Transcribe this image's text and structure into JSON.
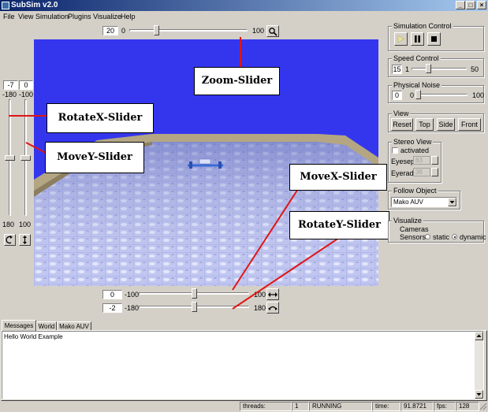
{
  "window": {
    "title": "SubSim v2.0",
    "min": "_",
    "max": "□",
    "close": "×"
  },
  "menu": [
    "File",
    "View",
    "Simulation",
    "Plugins",
    "Visualize",
    "Help"
  ],
  "zoom": {
    "value": "20",
    "min": "0",
    "max": "100",
    "fraction": 0.22
  },
  "rotate_x": {
    "value": "-7",
    "min": "-180",
    "max": "180",
    "fraction": 0.5
  },
  "move_y": {
    "value": "0",
    "min": "-100",
    "max": "100",
    "fraction": 0.5
  },
  "move_x": {
    "value": "0",
    "min": "-100",
    "max": "100",
    "fraction": 0.5
  },
  "rotate_y": {
    "value": "-2",
    "min": "-180",
    "max": "180",
    "fraction": 0.5
  },
  "annotations": {
    "zoom": "Zoom-Slider",
    "rotate_x": "RotateX-Slider",
    "move_y": "MoveY-Slider",
    "move_x": "MoveX-Slider",
    "rotate_y": "RotateY-Slider"
  },
  "simulation_control": {
    "title": "Simulation Control"
  },
  "speed_control": {
    "title": "Speed Control",
    "value": "15",
    "min": "1",
    "max": "50",
    "fraction": 0.28
  },
  "physical_noise": {
    "title": "Physical Noise",
    "value": "0",
    "min": "0",
    "max": "100",
    "fraction": 0.0
  },
  "view": {
    "title": "View",
    "buttons": [
      "Reset",
      "Top",
      "Side",
      "Front"
    ]
  },
  "stereo_view": {
    "title": "Stereo View",
    "activated": "activated",
    "eyesep_label": "Eyesep:",
    "eyesep": "63",
    "eyerad_label": "Eyerad:",
    "eyerad": "38"
  },
  "follow_object": {
    "title": "Follow Object",
    "selected": "Mako AUV"
  },
  "visualize": {
    "title": "Visualize",
    "cameras": "Cameras",
    "sensors_label": "Sensors",
    "static": "static",
    "dynamic": "dynamic"
  },
  "tabs": [
    "Messages",
    "World",
    "Mako AUV"
  ],
  "messages": {
    "text": "Hello World Example"
  },
  "status": {
    "threads_label": "threads:",
    "threads": "1",
    "state": "RUNNING",
    "time_label": "time:",
    "time": "91.8721",
    "fps_label": "fps:",
    "fps": "128"
  },
  "colors": {
    "sky": "#3436ee",
    "titlebar": "#0a246a",
    "annotation_line": "#e01515"
  }
}
